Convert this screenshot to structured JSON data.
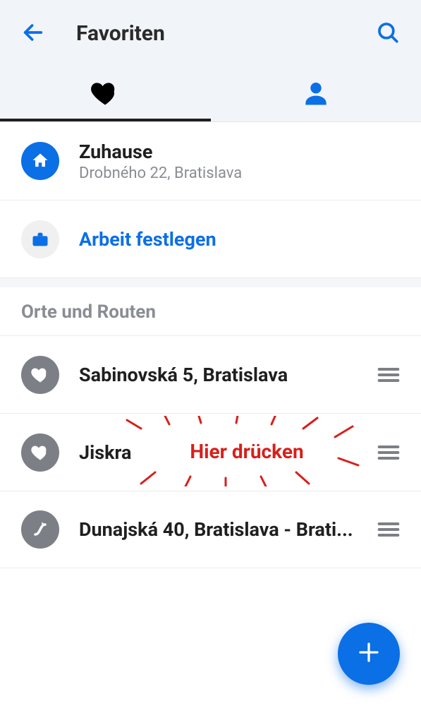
{
  "header": {
    "title": "Favoriten"
  },
  "tabs": {
    "favorites_active": true
  },
  "quick": {
    "home_label": "Zuhause",
    "home_address": "Drobného 22, Bratislava",
    "work_label": "Arbeit festlegen"
  },
  "section": {
    "title": "Orte und Routen"
  },
  "places": [
    {
      "name": "Sabinovská 5, Bratislava",
      "icon": "heart"
    },
    {
      "name": "Jiskra",
      "icon": "heart"
    },
    {
      "name": "Dunajská 40, Bratislava - Brati...",
      "icon": "route"
    }
  ],
  "annotation": {
    "text": "Hier drücken"
  }
}
